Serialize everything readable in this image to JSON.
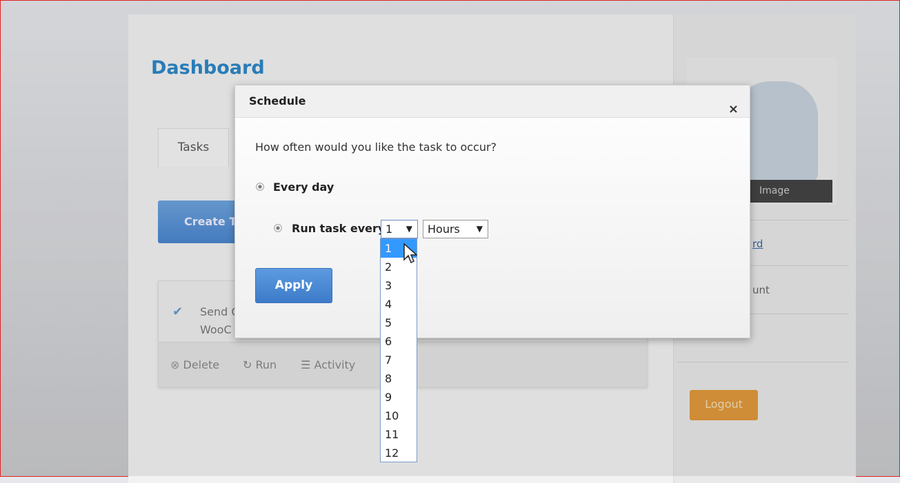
{
  "page": {
    "title": "Dashboard",
    "tabs": [
      {
        "label": "Tasks"
      }
    ],
    "create_label": "Create Task",
    "task": {
      "line1": "Send C",
      "line2": "WooC",
      "actions": {
        "delete": "Delete",
        "run": "Run",
        "activity": "Activity"
      }
    }
  },
  "sidebar": {
    "image_label": "Image",
    "link1": "rd",
    "link2": "unt",
    "logout": "Logout"
  },
  "modal": {
    "title": "Schedule",
    "close": "×",
    "question": "How often would you like the task to occur?",
    "option_every_day": "Every day",
    "option_run_every": "Run task every",
    "interval_value": "1",
    "unit_value": "Hours",
    "apply": "Apply",
    "interval_options": [
      "1",
      "2",
      "3",
      "4",
      "5",
      "6",
      "7",
      "8",
      "9",
      "10",
      "11",
      "12"
    ],
    "highlighted": "1"
  },
  "colors": {
    "accent": "#2d87c8",
    "apply": "#3c7bc9",
    "logout": "#e09a3b",
    "highlight": "#3399ff"
  }
}
